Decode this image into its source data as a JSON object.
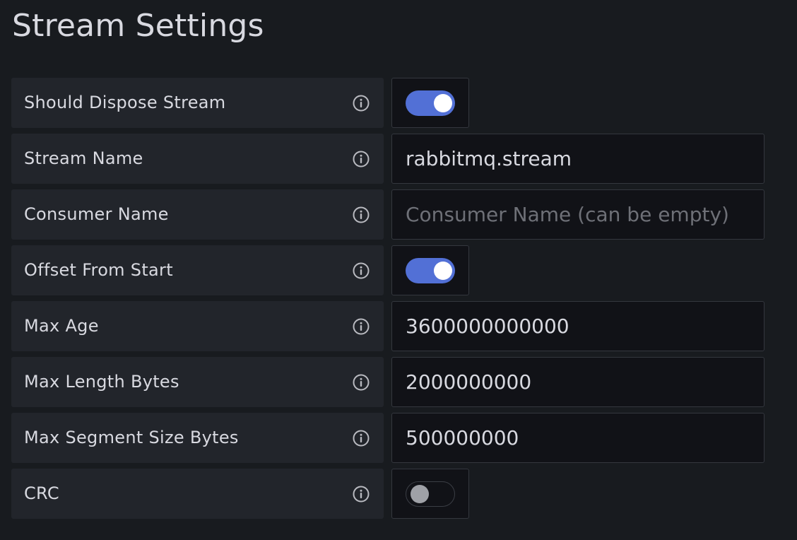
{
  "section": {
    "title": "Stream Settings"
  },
  "fields": [
    {
      "label": "Should Dispose Stream",
      "type": "switch",
      "checked": true
    },
    {
      "label": "Stream Name",
      "type": "text",
      "value": "rabbitmq.stream",
      "placeholder": ""
    },
    {
      "label": "Consumer Name",
      "type": "text",
      "value": "",
      "placeholder": "Consumer Name (can be empty)"
    },
    {
      "label": "Offset From Start",
      "type": "switch",
      "checked": true
    },
    {
      "label": "Max Age",
      "type": "text",
      "value": "3600000000000",
      "placeholder": ""
    },
    {
      "label": "Max Length Bytes",
      "type": "text",
      "value": "2000000000",
      "placeholder": ""
    },
    {
      "label": "Max Segment Size Bytes",
      "type": "text",
      "value": "500000000",
      "placeholder": ""
    },
    {
      "label": "CRC",
      "type": "switch",
      "checked": false
    }
  ],
  "icons": {
    "info": "info-circle-icon"
  },
  "colors": {
    "background": "#181b1f",
    "label_bg": "#22252b",
    "control_bg": "#111217",
    "accent": "#5270d6",
    "text": "#d8d9e0",
    "placeholder": "#6e7077"
  }
}
